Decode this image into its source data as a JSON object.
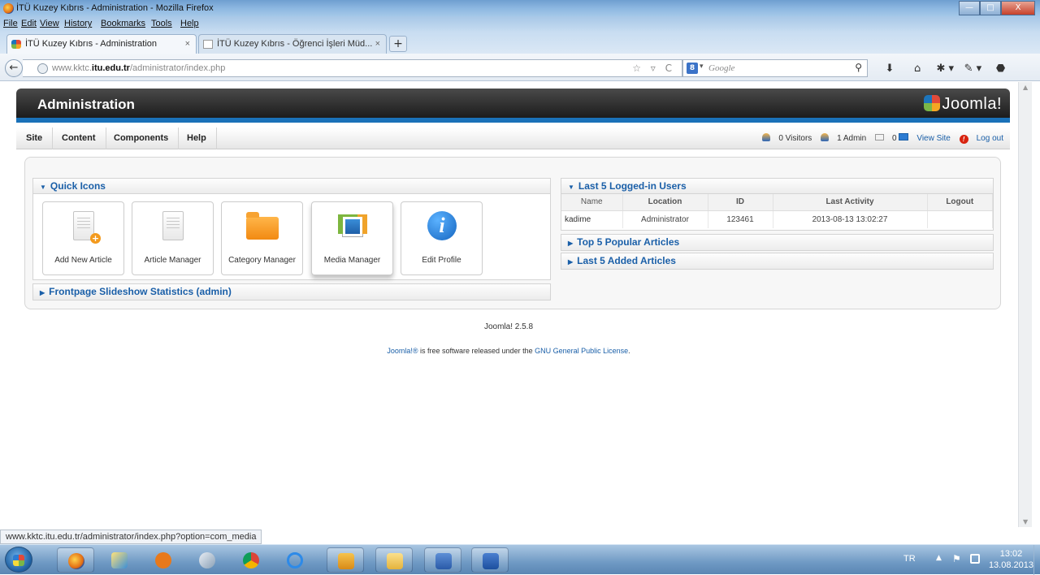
{
  "window": {
    "title": "İTÜ Kuzey Kıbrıs - Administration - Mozilla Firefox",
    "controls": {
      "minimize": "—",
      "maximize": "□",
      "close": "X"
    }
  },
  "menubar": [
    "File",
    "Edit",
    "View",
    "History",
    "Bookmarks",
    "Tools",
    "Help"
  ],
  "tabs": [
    {
      "label": "İTÜ Kuzey Kıbrıs - Administration",
      "close": "×"
    },
    {
      "label": "İTÜ Kuzey Kıbrıs - Öğrenci İşleri Müd...",
      "close": "×"
    }
  ],
  "new_tab": "+",
  "navigation": {
    "back": "←",
    "url_prefix": "www.kktc.",
    "url_domain": "itu.edu.tr",
    "url_path": "/administrator/index.php",
    "url_icons": "☆ ▿ C",
    "search_engine": "8",
    "search_placeholder": "Google",
    "search_icon": "⚲",
    "toolbar_icons": [
      "⬇",
      "⌂",
      "✱ ▾",
      "✎ ▾",
      "⬣"
    ]
  },
  "joomla": {
    "header_title": "Administration",
    "logo_text": "Joomla!",
    "logo_sup": "®",
    "menu": [
      "Site",
      "Content",
      "Components",
      "Help"
    ],
    "status": {
      "visitors": "0 Visitors",
      "admin": "1 Admin",
      "messages": "0",
      "view_site": "View Site",
      "logout": "Log out"
    },
    "quick_icons": {
      "title": "Quick Icons",
      "items": [
        {
          "label": "Add New Article",
          "icon": "add-article-icon"
        },
        {
          "label": "Article Manager",
          "icon": "article-icon"
        },
        {
          "label": "Category Manager",
          "icon": "folder-icon"
        },
        {
          "label": "Media Manager",
          "icon": "media-icon"
        },
        {
          "label": "Edit Profile",
          "icon": "info-icon"
        }
      ]
    },
    "slideshow_panel": "Frontpage Slideshow Statistics (admin)",
    "logged_users": {
      "title": "Last 5 Logged-in Users",
      "columns": [
        "Name",
        "Location",
        "ID",
        "Last Activity",
        "Logout"
      ],
      "rows": [
        [
          "kadime",
          "Administrator",
          "123461",
          "2013-08-13 13:02:27",
          ""
        ]
      ]
    },
    "popular_panel": "Top 5 Popular Articles",
    "added_panel": "Last 5 Added Articles",
    "version": "Joomla! 2.5.8",
    "license_link1": "Joomla!®",
    "license_text": " is free software released under the ",
    "license_link2": "GNU General Public License",
    "license_end": "."
  },
  "status_url": "www.kktc.itu.edu.tr/administrator/index.php?option=com_media",
  "tray": {
    "language": "TR",
    "time": "13:02",
    "date": "13.08.2013"
  }
}
